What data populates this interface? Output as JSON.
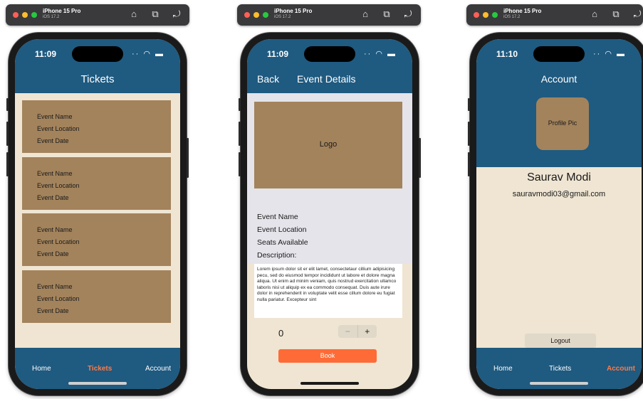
{
  "simulator": {
    "device": "iPhone 15 Pro",
    "os": "iOS 17.2",
    "tools": [
      "⌂",
      "⧉",
      "⤾"
    ]
  },
  "status": {
    "time1": "11:09",
    "time2": "11:09",
    "time3": "11:10",
    "signal": "·· ◠ ▬"
  },
  "tabs": {
    "home": "Home",
    "tickets": "Tickets",
    "account": "Account"
  },
  "tickets_screen": {
    "title": "Tickets",
    "cards": [
      {
        "name": "Event Name",
        "location": "Event Location",
        "date": "Event Date"
      },
      {
        "name": "Event Name",
        "location": "Event Location",
        "date": "Event Date"
      },
      {
        "name": "Event Name",
        "location": "Event Location",
        "date": "Event Date"
      },
      {
        "name": "Event Name",
        "location": "Event Location",
        "date": "Event Date"
      }
    ]
  },
  "event_screen": {
    "back": "Back",
    "title": "Event Details",
    "logo": "Logo",
    "name": "Event Name",
    "location": "Event Location",
    "seats": "Seats Available",
    "description_label": "Description:",
    "description": "Lorem ipsum dolor sit er elit lamet, consectetaur cillium adipisicing pecu, sed do eiusmod tempor incididunt ut labore et dolore magna aliqua. Ut enim ad minim veniam, quis nostrud exercitation ullamco laboris nisi ut aliquip ex ea commodo consequat. Duis aute irure dolor in reprehenderit in voluptate velit esse cillum dolore eu fugiat nulla pariatur. Excepteur sint",
    "quantity": "0",
    "minus": "−",
    "plus": "+",
    "book": "Book"
  },
  "account_screen": {
    "title": "Account",
    "profile_pic": "Profile Pic",
    "name": "Saurav Modi",
    "email": "sauravmodi03@gmail.com",
    "logout": "Logout"
  },
  "colors": {
    "nav": "#1f5a80",
    "card": "#a3835c",
    "background": "#efe5d2",
    "accent": "#ff6b36"
  }
}
